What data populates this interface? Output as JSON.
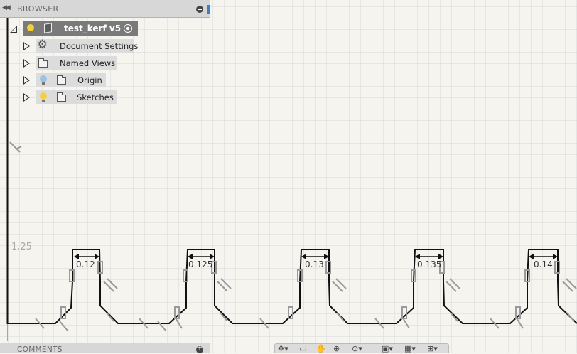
{
  "browser": {
    "title": "BROWSER",
    "root_label": "test_kerf v5",
    "items": [
      {
        "label": "Document Settings"
      },
      {
        "label": "Named Views"
      },
      {
        "label": "Origin"
      },
      {
        "label": "Sketches"
      }
    ]
  },
  "comments": {
    "title": "COMMENTS"
  },
  "sketch": {
    "axis_label": "1.25",
    "dimensions": [
      "0.12",
      "0.125",
      "0.13",
      "0.135",
      "0.14"
    ]
  },
  "colors": {
    "bulb_on": "#f4d03f",
    "bulb_off": "#9cc3e6",
    "sketch_line": "#111111",
    "constraint": "#9a9a9a"
  },
  "icons": [
    "collapse-icon",
    "minus-icon",
    "pin-icon",
    "bulb-icon",
    "document-icon",
    "target-icon",
    "gear-icon",
    "folder-icon",
    "plus-icon",
    "orbit-icon",
    "pan-icon",
    "zoom-icon",
    "display-icon",
    "grid-icon",
    "viewports-icon"
  ]
}
